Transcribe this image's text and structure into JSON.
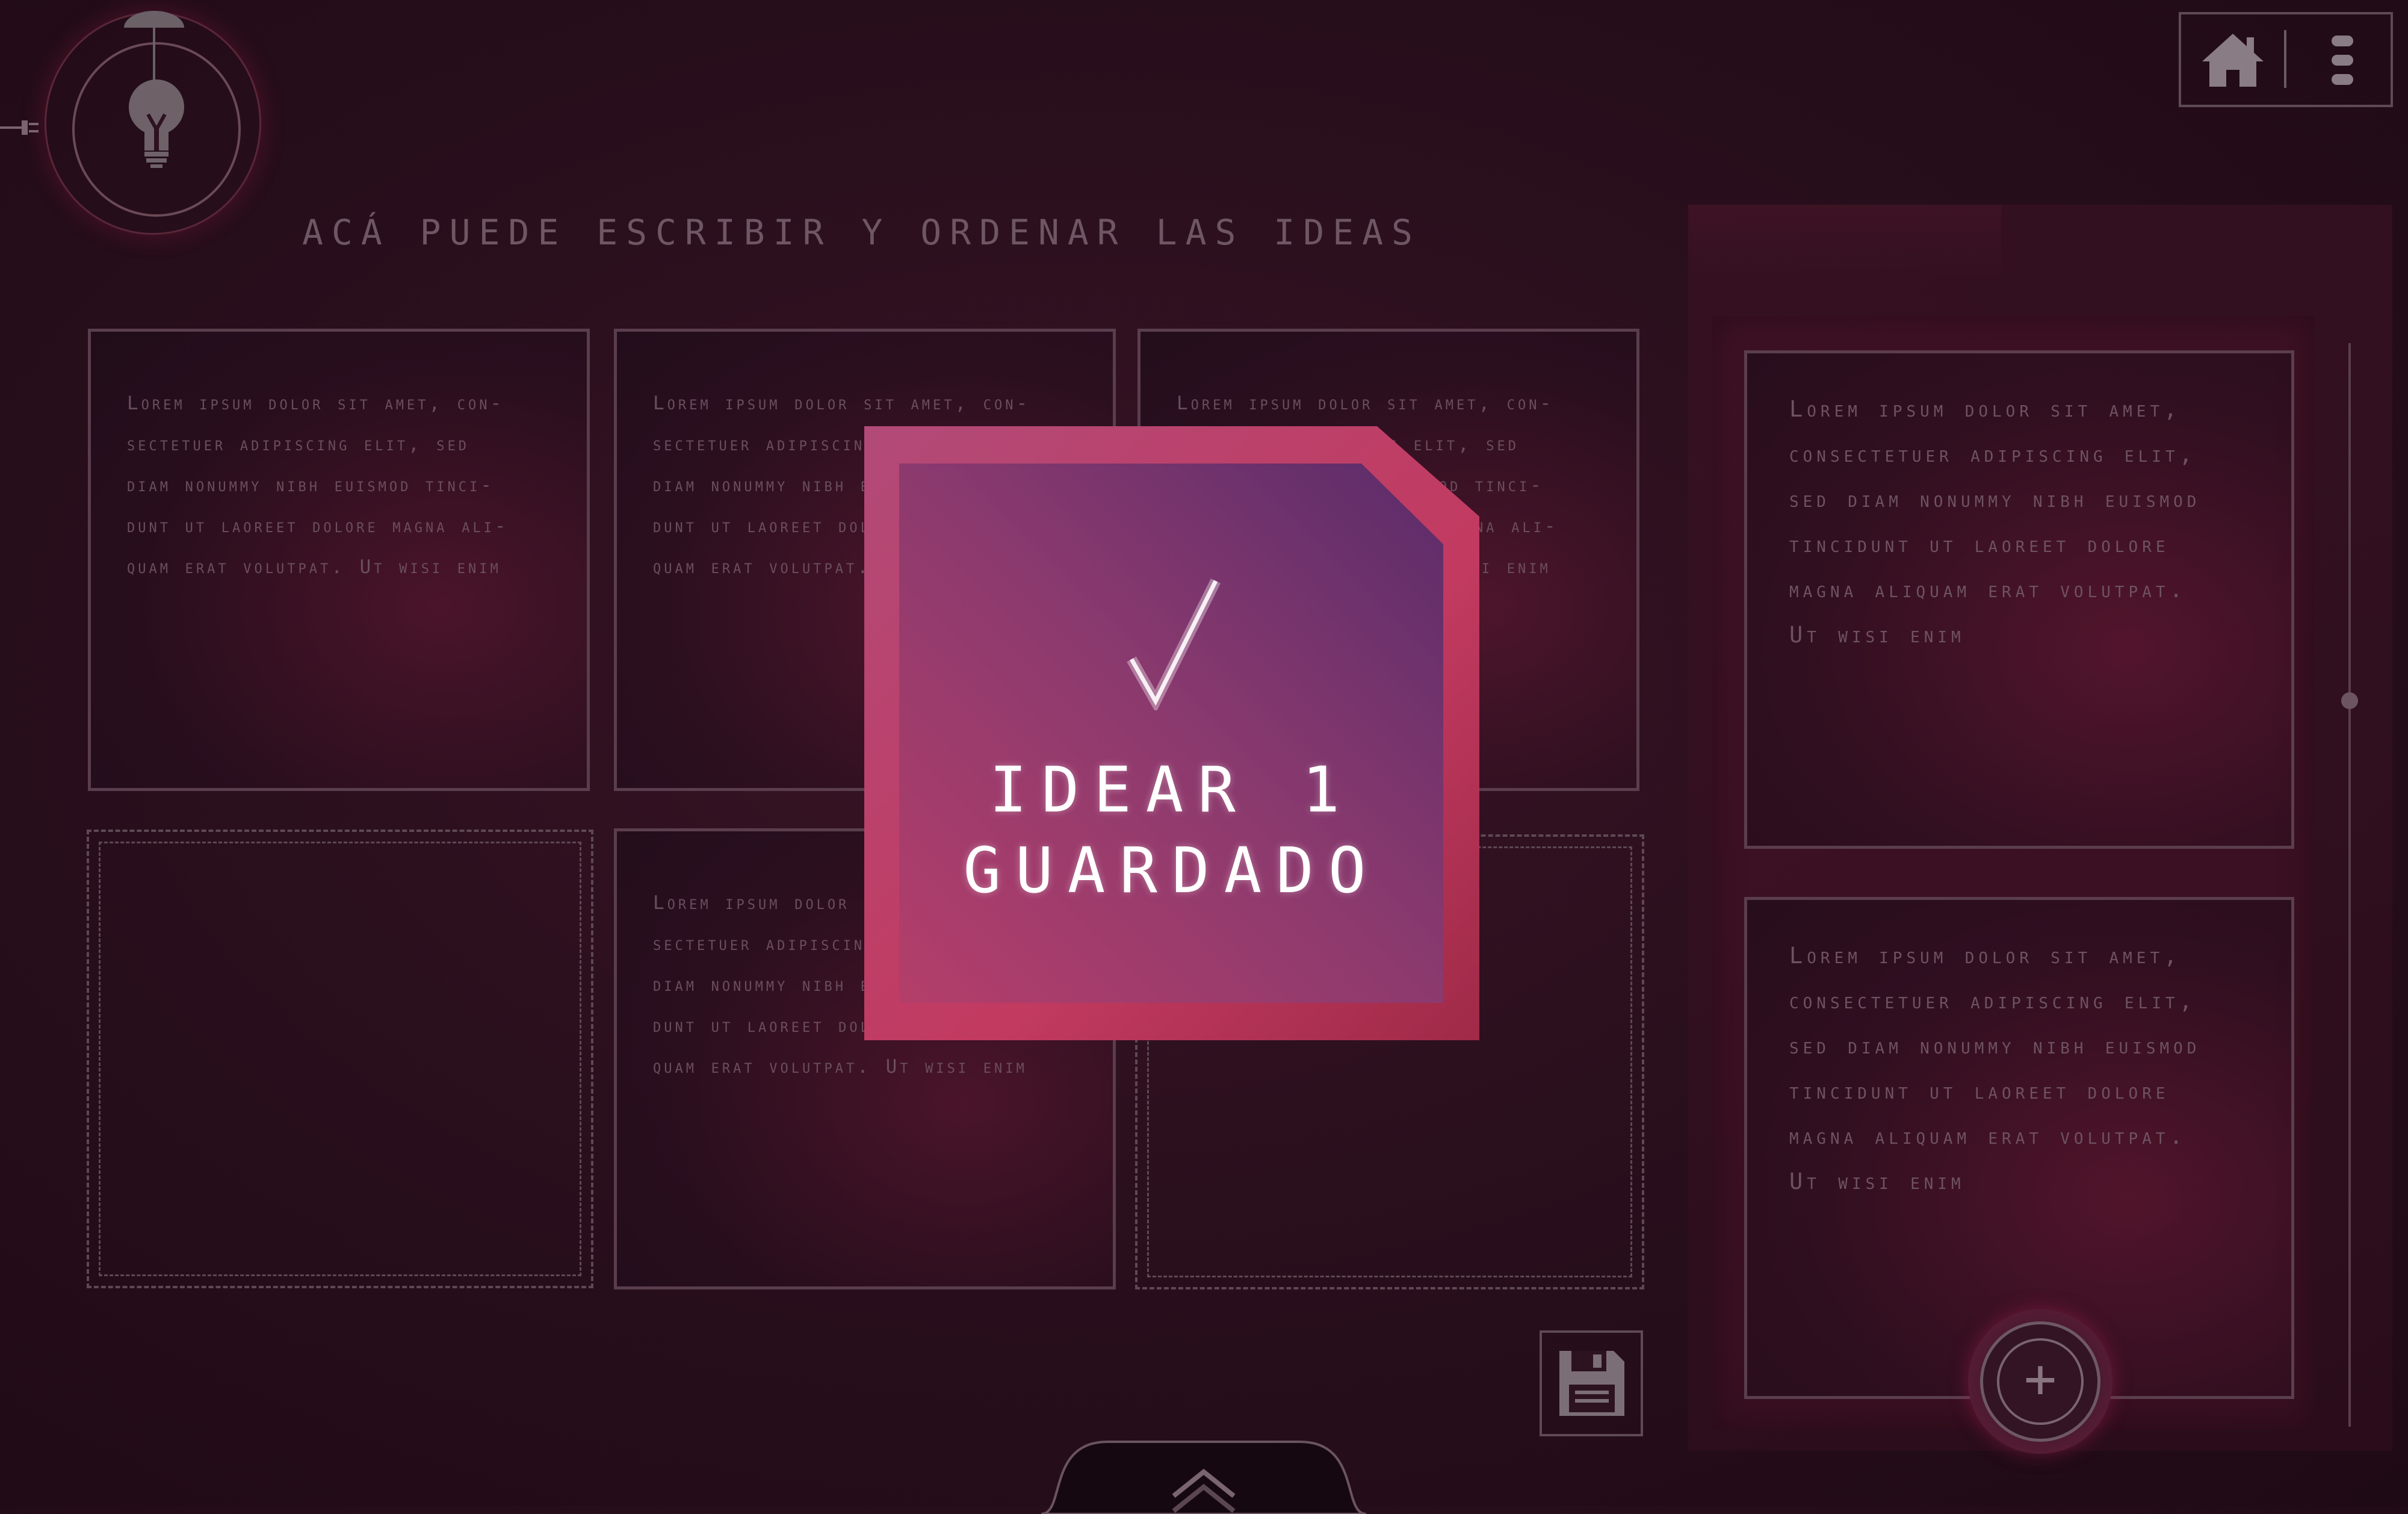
{
  "header": {
    "instruction": "ACÁ PUEDE ESCRIBIR Y ORDENAR LAS IDEAS",
    "logo_icon": "lightbulb-icon",
    "home_icon": "home-icon",
    "menu_icon": "kebab-menu-icon"
  },
  "cards": [
    {
      "type": "filled",
      "text": "Lorem ipsum dolor sit amet, con-\nsectetuer adipiscing elit, sed\ndiam nonummy nibh euismod tinci-\ndunt ut laoreet dolore magna ali-\nquam erat volutpat. Ut wisi enim"
    },
    {
      "type": "filled",
      "text": "Lorem ipsum dolor sit amet, con-\nsectetuer adipiscing elit, sed\ndiam nonummy nibh euismod tinci-\ndunt ut laoreet dolore magna ali-\nquam erat volutpat. Ut wisi enim"
    },
    {
      "type": "filled",
      "text": "Lorem ipsum dolor sit amet, con-\nsectetuer adipiscing elit, sed\ndiam nonummy nibh euismod tinci-\ndunt ut laoreet dolore magna ali-\nquam erat volutpat. Ut wisi enim"
    },
    {
      "type": "empty-slot",
      "text": ""
    },
    {
      "type": "filled",
      "text": "Lorem ipsum dolor sit amet, con-\nsectetuer adipiscing elit, sed\ndiam nonummy nibh euismod tinci-\ndunt ut laoreet dolore magna ali-\nquam erat volutpat. Ut wisi enim"
    },
    {
      "type": "empty-slot",
      "text": ""
    }
  ],
  "side_panel": {
    "cards": [
      {
        "text": "Lorem ipsum dolor sit amet,\nconsectetuer adipiscing elit,\nsed diam nonummy nibh euismod\ntincidunt ut laoreet dolore\nmagna aliquam erat volutpat.\nUt wisi enim"
      },
      {
        "text": "Lorem ipsum dolor sit amet,\nconsectetuer adipiscing elit,\nsed diam nonummy nibh euismod\ntincidunt ut laoreet dolore\nmagna aliquam erat volutpat.\nUt wisi enim"
      }
    ],
    "add_label": "+"
  },
  "save_icon": "floppy-disk-icon",
  "bottom_tab_icon": "chevron-up-icon",
  "modal": {
    "title": "IDEAR 1\nGUARDADO",
    "icon": "checkmark-icon"
  },
  "colors": {
    "background": "#2a0f1d",
    "modal_border": "#c2385f",
    "modal_fill": "#7a3a6a",
    "card_border": "#5b3e4d",
    "text_muted": "#6b4e5d"
  }
}
